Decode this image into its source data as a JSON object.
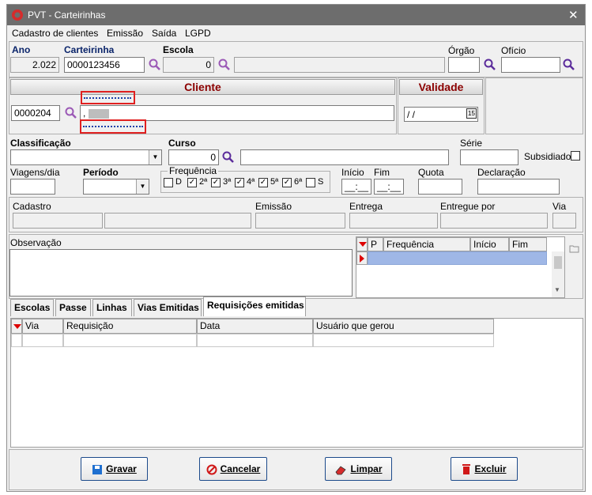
{
  "window": {
    "title": "PVT - Carteirinhas",
    "close_glyph": "✕"
  },
  "menu": [
    "Cadastro de clientes",
    "Emissão",
    "Saída",
    "LGPD"
  ],
  "top_fields": {
    "ano_label": "Ano",
    "ano_value": "2.022",
    "carteirinha_label": "Carteirinha",
    "carteirinha_value": "0000123456",
    "escola_label": "Escola",
    "escola_code": "0",
    "escola_name": "",
    "orgao_label": "Órgão",
    "orgao_value": "",
    "oficio_label": "Ofício",
    "oficio_value": ""
  },
  "cliente": {
    "header": "Cliente",
    "code": "0000204",
    "name": "",
    "partial_name": ",",
    "validade_header": "Validade",
    "validade_value": " /  /",
    "calendar_glyph": "15"
  },
  "classificacao": {
    "classificacao_label": "Classificação",
    "classificacao_value": "",
    "curso_label": "Curso",
    "curso_code": "0",
    "curso_name": "",
    "serie_label": "Série",
    "serie_value": "",
    "subsidiado_label": "Subsidiado"
  },
  "viagens": {
    "viagens_label": "Viagens/dia",
    "viagens_value": "",
    "periodo_label": "Período",
    "periodo_value": "",
    "frequencia_label": "Frequência",
    "days": [
      {
        "label": "D",
        "checked": false
      },
      {
        "label": "2ª",
        "checked": true
      },
      {
        "label": "3ª",
        "checked": true
      },
      {
        "label": "4ª",
        "checked": true
      },
      {
        "label": "5ª",
        "checked": true
      },
      {
        "label": "6ª",
        "checked": true
      },
      {
        "label": "S",
        "checked": false
      }
    ],
    "inicio_label": "Início",
    "inicio_value": "__:__",
    "fim_label": "Fim",
    "fim_value": "__:__",
    "quota_label": "Quota",
    "quota_value": "",
    "declaracao_label": "Declaração",
    "declaracao_value": ""
  },
  "info": {
    "cadastro_label": "Cadastro",
    "emissao_label": "Emissão",
    "entrega_label": "Entrega",
    "entregue_por_label": "Entregue por",
    "via_label": "Via"
  },
  "observacao": {
    "label": "Observação",
    "value": ""
  },
  "freq_grid": {
    "columns": [
      "P",
      "Frequência",
      "Início",
      "Fim"
    ]
  },
  "tabs": [
    {
      "label": "Escolas",
      "active": false
    },
    {
      "label": "Passe",
      "active": false
    },
    {
      "label": "Linhas",
      "active": false
    },
    {
      "label": "Vias Emitidas",
      "active": false
    },
    {
      "label": "Requisições emitidas",
      "active": true
    }
  ],
  "req_grid": {
    "columns": [
      "Via",
      "Requisição",
      "Data",
      "Usuário que gerou"
    ]
  },
  "buttons": {
    "gravar": "Gravar",
    "cancelar": "Cancelar",
    "limpar": "Limpar",
    "excluir": "Excluir"
  },
  "colors": {
    "titlebar": "#6d6d6d",
    "accent_header": "#8b0000",
    "selected_row": "#9fb7e6",
    "redbox": "#e02020"
  }
}
